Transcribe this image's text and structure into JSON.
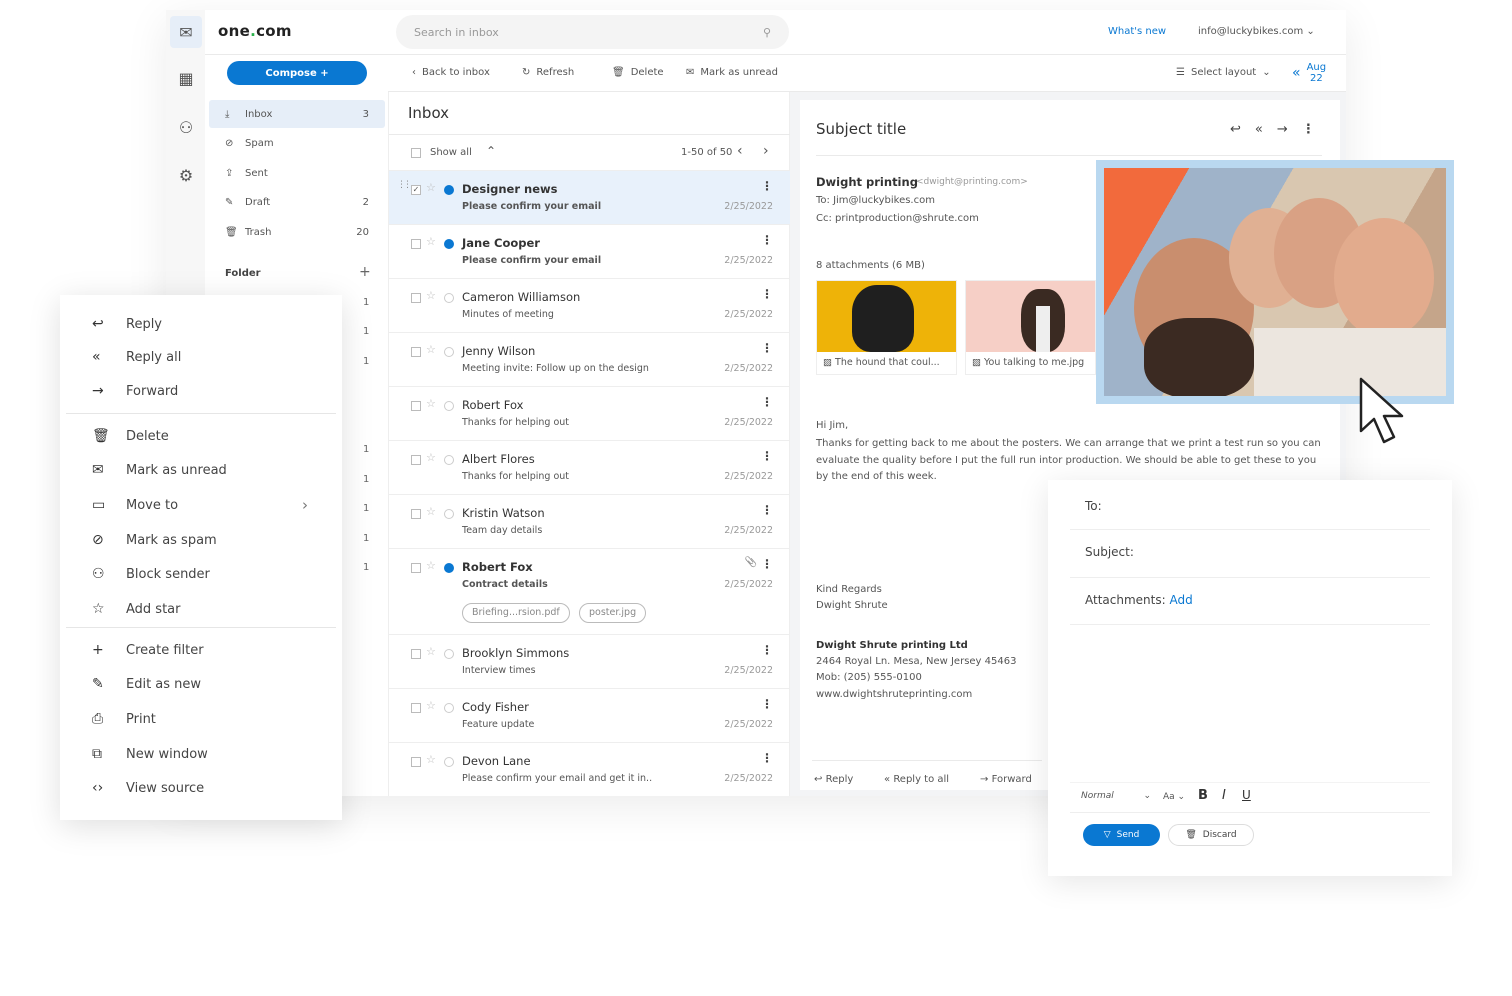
{
  "colors": {
    "accent": "#0a78d2",
    "selected_row": "#e8f1fb",
    "photo_frame": "#b9d8f0"
  },
  "header": {
    "logo": "one.com",
    "search_placeholder": "Search in inbox",
    "whats_new": "What's new",
    "account": "info@luckybikes.com"
  },
  "rail": {
    "icons": [
      "mail-icon",
      "calendar-icon",
      "contacts-icon",
      "settings-icon"
    ]
  },
  "sidebar": {
    "compose": "Compose +",
    "folders": [
      {
        "label": "Inbox",
        "icon": "inbox-icon",
        "count": "3"
      },
      {
        "label": "Spam",
        "icon": "spam-icon",
        "count": ""
      },
      {
        "label": "Sent",
        "icon": "sent-icon",
        "count": ""
      },
      {
        "label": "Draft",
        "icon": "draft-icon",
        "count": "2"
      },
      {
        "label": "Trash",
        "icon": "trash-icon",
        "count": "20"
      }
    ],
    "folder_heading": "Folder",
    "folder_counts": [
      "1",
      "1",
      "1",
      "1",
      "1",
      "1",
      "1",
      "1"
    ]
  },
  "toolbar": {
    "back": "Back to inbox",
    "refresh": "Refresh",
    "delete": "Delete",
    "mark_unread": "Mark as unread",
    "select_layout": "Select layout",
    "date_month": "Aug",
    "date_day": "22"
  },
  "list": {
    "title": "Inbox",
    "show_all": "Show all",
    "pagination": "1-50 of 50",
    "emails": [
      {
        "sender": "Designer news",
        "subject": "Please confirm your email",
        "date": "2/25/2022",
        "unread": true,
        "selected": true,
        "checked": true
      },
      {
        "sender": "Jane Cooper",
        "subject": "Please confirm your email",
        "date": "2/25/2022",
        "unread": true
      },
      {
        "sender": "Cameron Williamson",
        "subject": "Minutes of meeting",
        "date": "2/25/2022"
      },
      {
        "sender": "Jenny Wilson",
        "subject": "Meeting invite: Follow up on the design",
        "date": "2/25/2022"
      },
      {
        "sender": "Robert Fox",
        "subject": "Thanks for helping out",
        "date": "2/25/2022"
      },
      {
        "sender": "Albert Flores",
        "subject": "Thanks for helping out",
        "date": "2/25/2022"
      },
      {
        "sender": "Kristin Watson",
        "subject": "Team day details",
        "date": "2/25/2022"
      },
      {
        "sender": "Robert Fox",
        "subject": "Contract details",
        "date": "2/25/2022",
        "unread": true,
        "attachment": true,
        "chips": [
          "Briefing...rsion.pdf",
          "poster.jpg"
        ]
      },
      {
        "sender": "Brooklyn Simmons",
        "subject": "Interview times",
        "date": "2/25/2022"
      },
      {
        "sender": "Cody Fisher",
        "subject": "Feature update",
        "date": "2/25/2022"
      },
      {
        "sender": "Devon Lane",
        "subject": "Please confirm your email and get it in..",
        "date": "2/25/2022"
      }
    ]
  },
  "reader": {
    "subject": "Subject title",
    "from_name": "Dwight printing",
    "from_email": "<dwight@printing.com>",
    "to": "To: Jim@luckybikes.com",
    "cc": "Cc: printproduction@shrute.com",
    "attachments_label": "8 attachments (6 MB)",
    "attachments": [
      "The hound that coul...",
      "You talking to me.jpg"
    ],
    "body": [
      "Hi Jim,",
      "Thanks for getting back to me about the posters. We can arrange that we print a test run so you can evaluate the quality before I put the full run intor production. We should be able to get these to you by the end of this week."
    ],
    "regards": [
      "Kind Regards",
      "Dwight Shrute"
    ],
    "signature": [
      "Dwight Shrute printing Ltd",
      "2464 Royal Ln. Mesa, New Jersey 45463",
      "Mob: (205) 555-0100",
      "www.dwightshruteprinting.com"
    ],
    "reply": "Reply",
    "reply_all": "Reply to all",
    "forward": "Forward"
  },
  "context_menu": {
    "items": [
      {
        "label": "Reply",
        "icon": "reply-icon",
        "glyph": "↩"
      },
      {
        "label": "Reply all",
        "icon": "reply-all-icon",
        "glyph": "«"
      },
      {
        "label": "Forward",
        "icon": "forward-icon",
        "glyph": "→"
      },
      {
        "label": "Delete",
        "icon": "trash-icon",
        "glyph": "🗑"
      },
      {
        "label": "Mark as unread",
        "icon": "envelope-icon",
        "glyph": "✉"
      },
      {
        "label": "Move to",
        "icon": "folder-icon",
        "glyph": "▭",
        "submenu": true
      },
      {
        "label": "Mark as spam",
        "icon": "spam-icon",
        "glyph": "⊘"
      },
      {
        "label": "Block sender",
        "icon": "block-user-icon",
        "glyph": "⚇"
      },
      {
        "label": "Add star",
        "icon": "star-icon",
        "glyph": "☆"
      },
      {
        "label": "Create filter",
        "icon": "plus-icon",
        "glyph": "+"
      },
      {
        "label": "Edit as new",
        "icon": "edit-icon",
        "glyph": "✎"
      },
      {
        "label": "Print",
        "icon": "print-icon",
        "glyph": "⎙"
      },
      {
        "label": "New window",
        "icon": "new-window-icon",
        "glyph": "⧉"
      },
      {
        "label": "View source",
        "icon": "code-icon",
        "glyph": "‹›"
      }
    ]
  },
  "compose": {
    "to": "To:",
    "subject": "Subject:",
    "attachments": "Attachments:",
    "add": "Add",
    "format": "Normal",
    "size": "Aa",
    "bold": "B",
    "italic": "I",
    "underline": "U",
    "send": "Send",
    "discard": "Discard"
  }
}
